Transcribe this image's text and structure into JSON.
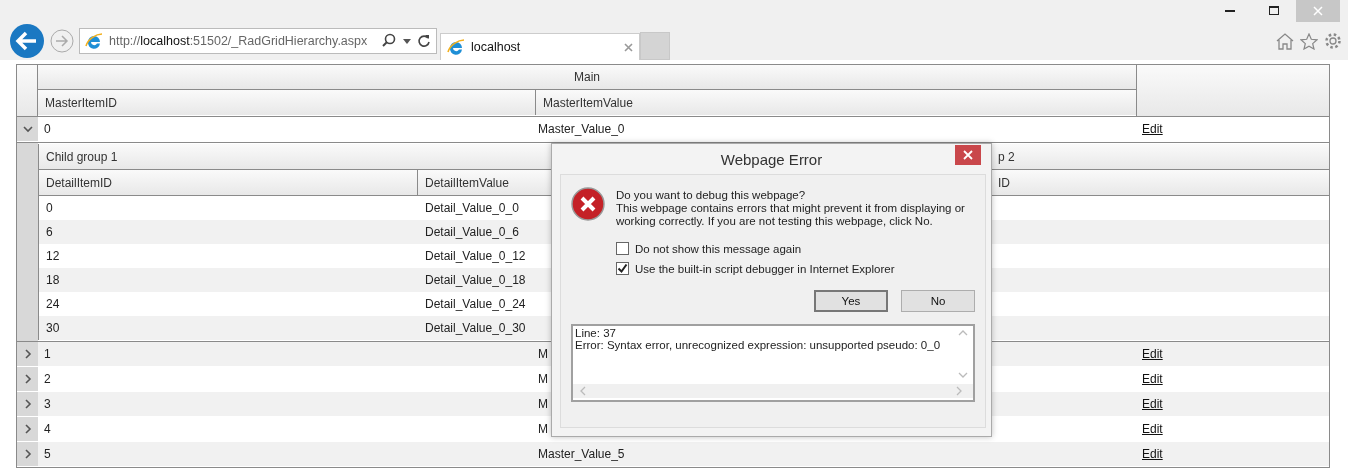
{
  "browser": {
    "address": "http://**localhost**:51502/_RadGridHierarchy.aspx",
    "tab": {
      "label": "localhost"
    }
  },
  "grid": {
    "group_header": "Main",
    "columns": [
      "MasterItemID",
      "MasterItemValue"
    ],
    "rows": [
      {
        "id": "0",
        "value": "Master_Value_0",
        "edit": "Edit",
        "expanded": true,
        "detail": {
          "groups": [
            {
              "title": "Child group 1",
              "columns": [
                "DetailItemID",
                "DetailItemValue"
              ],
              "rows": [
                [
                  "0",
                  "Detail_Value_0_0"
                ],
                [
                  "6",
                  "Detail_Value_0_6"
                ],
                [
                  "12",
                  "Detail_Value_0_12"
                ],
                [
                  "18",
                  "Detail_Value_0_18"
                ],
                [
                  "24",
                  "Detail_Value_0_24"
                ],
                [
                  "30",
                  "Detail_Value_0_30"
                ]
              ]
            },
            {
              "title": "p 2",
              "columns": [
                "ID"
              ]
            }
          ]
        }
      },
      {
        "id": "1",
        "value": "M",
        "edit": "Edit",
        "expanded": false
      },
      {
        "id": "2",
        "value": "M",
        "edit": "Edit",
        "expanded": false
      },
      {
        "id": "3",
        "value": "M",
        "edit": "Edit",
        "expanded": false
      },
      {
        "id": "4",
        "value": "M",
        "edit": "Edit",
        "expanded": false
      },
      {
        "id": "5",
        "value": "Master_Value_5",
        "edit": "Edit",
        "expanded": false
      }
    ]
  },
  "dialog": {
    "title": "Webpage Error",
    "heading": "Do you want to debug this webpage?",
    "message": "This webpage contains errors that might prevent it from displaying or working correctly. If you are not testing this webpage, click No.",
    "checkboxes": [
      {
        "label": "Do not show this message again",
        "checked": false
      },
      {
        "label": "Use the built-in script debugger in Internet Explorer",
        "checked": true
      }
    ],
    "buttons": [
      "Yes",
      "No"
    ],
    "details": [
      "Line: 37",
      "Error: Syntax error, unrecognized expression: unsupported pseudo: 0_0"
    ]
  }
}
